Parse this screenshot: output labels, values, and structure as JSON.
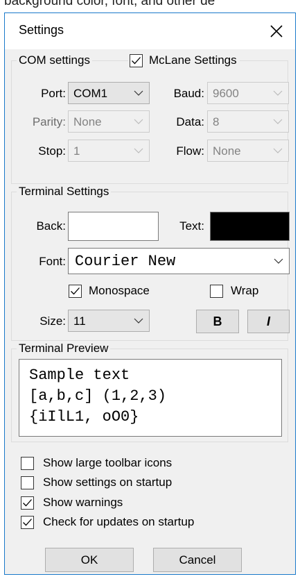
{
  "partial_caption": "background color, font, and other de",
  "window": {
    "title": "Settings"
  },
  "com": {
    "legend": "COM settings",
    "mclane_label": "McLane Settings",
    "mclane_checked": true,
    "port_label": "Port:",
    "port_value": "COM1",
    "baud_label": "Baud:",
    "baud_value": "9600",
    "parity_label": "Parity:",
    "parity_value": "None",
    "data_label": "Data:",
    "data_value": "8",
    "stop_label": "Stop:",
    "stop_value": "1",
    "flow_label": "Flow:",
    "flow_value": "None"
  },
  "terminal": {
    "legend": "Terminal Settings",
    "back_label": "Back:",
    "back_color": "#ffffff",
    "text_label": "Text:",
    "text_color": "#000000",
    "font_label": "Font:",
    "font_value": "Courier New",
    "monospace_label": "Monospace",
    "monospace_checked": true,
    "wrap_label": "Wrap",
    "wrap_checked": false,
    "size_label": "Size:",
    "size_value": "11",
    "bold_label": "B",
    "italic_label": "I"
  },
  "preview": {
    "legend": "Terminal Preview",
    "lines": [
      "Sample text",
      "[a,b,c] (1,2,3)",
      "{iIlL1, oO0}"
    ]
  },
  "options": [
    {
      "label": "Show large toolbar icons",
      "checked": false
    },
    {
      "label": "Show settings on startup",
      "checked": false
    },
    {
      "label": "Show warnings",
      "checked": true
    },
    {
      "label": "Check for updates on startup",
      "checked": true
    }
  ],
  "buttons": {
    "ok": "OK",
    "cancel": "Cancel"
  },
  "icons": {
    "close": "close-icon",
    "dropdown": "chevron-down-icon",
    "check": "checkmark-icon"
  }
}
